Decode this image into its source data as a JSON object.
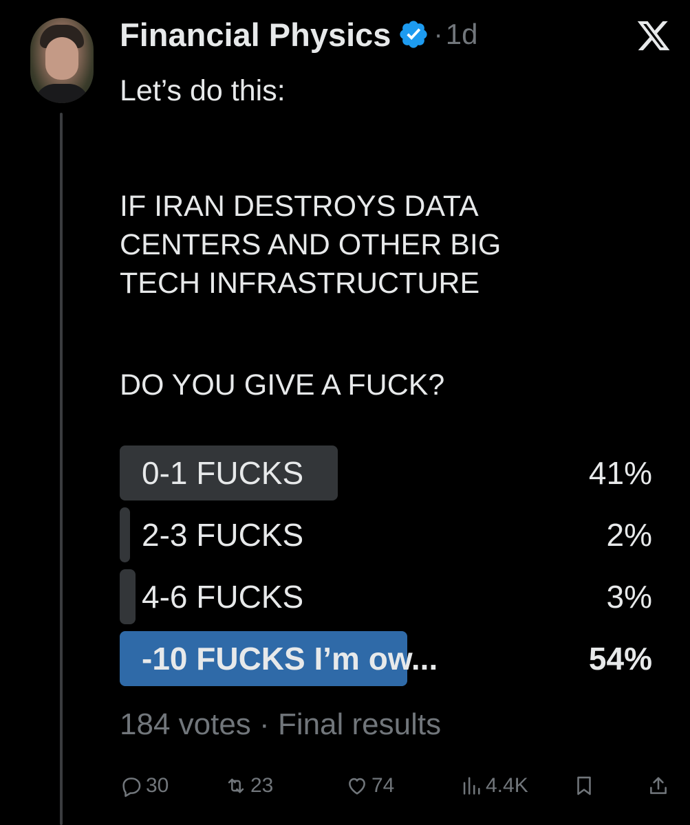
{
  "tweet": {
    "author": {
      "display_name": "Financial Physics",
      "verified": true,
      "separator": "·",
      "time": "1d"
    },
    "text_lines": [
      "Let’s do this:",
      "IF IRAN DESTROYS DATA",
      "CENTERS AND OTHER BIG",
      "TECH INFRASTRUCTURE",
      "DO YOU GIVE A FUCK?"
    ],
    "poll": {
      "options": [
        {
          "label": "0-1 FUCKS",
          "percent_text": "41%",
          "percent": 41,
          "winner": false
        },
        {
          "label": "2-3 FUCKS",
          "percent_text": "2%",
          "percent": 2,
          "winner": false
        },
        {
          "label": "4-6 FUCKS",
          "percent_text": "3%",
          "percent": 3,
          "winner": false
        },
        {
          "label": "-10 FUCKS I’m ow...",
          "percent_text": "54%",
          "percent": 54,
          "winner": true
        }
      ],
      "votes": "184 votes",
      "separator": "·",
      "status": "Final results"
    },
    "actions": {
      "replies": "30",
      "reposts": "23",
      "likes": "74",
      "views": "4.4K"
    }
  },
  "colors": {
    "background": "#000000",
    "text": "#e7e9ea",
    "muted": "#71767b",
    "poll_bar": "#333639",
    "poll_winner": "#2f6aa8",
    "verified": "#1d9bf0"
  },
  "icons": {
    "close": "x-logo-icon",
    "verified": "verified-badge-icon",
    "reply": "reply-icon",
    "repost": "repost-icon",
    "like": "heart-icon",
    "views": "views-icon",
    "bookmark": "bookmark-icon",
    "share": "share-icon"
  }
}
